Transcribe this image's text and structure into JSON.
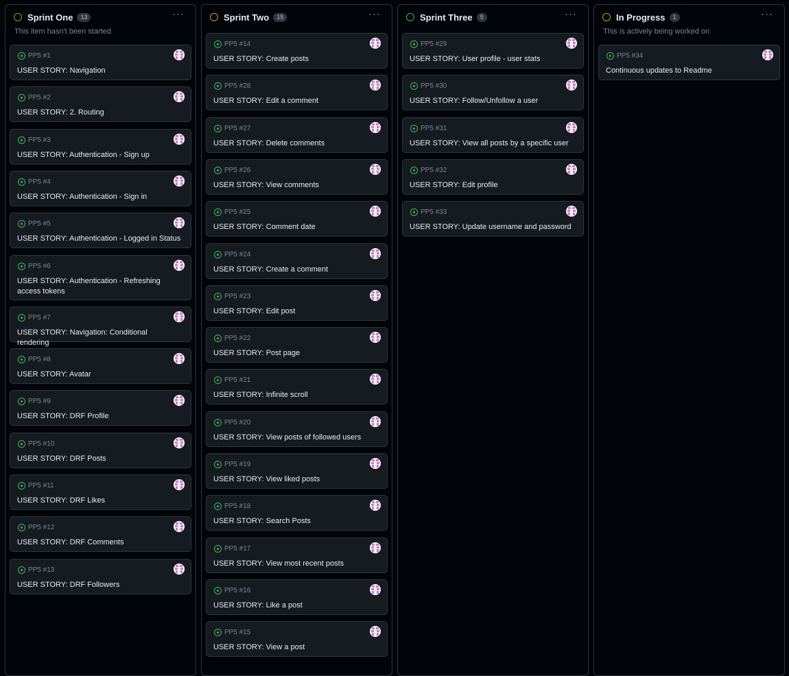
{
  "columns": [
    {
      "title": "Sprint One",
      "count": "13",
      "description": "This item hasn't been started",
      "status_color": "#3fb950",
      "items": [
        {
          "id": "PP5 #1",
          "title": "USER STORY: Navigation"
        },
        {
          "id": "PP5 #2",
          "title": "USER STORY: 2. Routing"
        },
        {
          "id": "PP5 #3",
          "title": "USER STORY: Authentication - Sign up"
        },
        {
          "id": "PP5 #4",
          "title": "USER STORY: Authentication - Sign in"
        },
        {
          "id": "PP5 #5",
          "title": "USER STORY: Authentication - Logged in Status"
        },
        {
          "id": "PP5 #6",
          "title": "USER STORY: Authentication - Refreshing access tokens"
        },
        {
          "id": "PP5 #7",
          "title": "USER STORY: Navigation: Conditional rendering"
        },
        {
          "id": "PP5 #8",
          "title": "USER STORY: Avatar"
        },
        {
          "id": "PP5 #9",
          "title": "USER STORY: DRF Profile"
        },
        {
          "id": "PP5 #10",
          "title": "USER STORY: DRF Posts"
        },
        {
          "id": "PP5 #11",
          "title": "USER STORY: DRF Likes"
        },
        {
          "id": "PP5 #12",
          "title": "USER STORY: DRF Comments"
        },
        {
          "id": "PP5 #13",
          "title": "USER STORY: DRF Followers"
        }
      ]
    },
    {
      "title": "Sprint Two",
      "count": "15",
      "description": "",
      "status_color": "#d29922",
      "items": [
        {
          "id": "PP5 #14",
          "title": "USER STORY: Create posts"
        },
        {
          "id": "PP5 #28",
          "title": "USER STORY: Edit a comment"
        },
        {
          "id": "PP5 #27",
          "title": "USER STORY: Delete comments"
        },
        {
          "id": "PP5 #26",
          "title": "USER STORY: View comments"
        },
        {
          "id": "PP5 #25",
          "title": "USER STORY: Comment date"
        },
        {
          "id": "PP5 #24",
          "title": "USER STORY: Create a comment"
        },
        {
          "id": "PP5 #23",
          "title": "USER STORY: Edit post"
        },
        {
          "id": "PP5 #22",
          "title": "USER STORY: Post page"
        },
        {
          "id": "PP5 #21",
          "title": "USER STORY: Infinite scroll"
        },
        {
          "id": "PP5 #20",
          "title": "USER STORY: View posts of followed users"
        },
        {
          "id": "PP5 #19",
          "title": "USER STORY: View liked posts"
        },
        {
          "id": "PP5 #18",
          "title": "USER STORY: Search Posts"
        },
        {
          "id": "PP5 #17",
          "title": "USER STORY: View most recent posts"
        },
        {
          "id": "PP5 #16",
          "title": "USER STORY: Like a post"
        },
        {
          "id": "PP5 #15",
          "title": "USER STORY: View a post"
        }
      ]
    },
    {
      "title": "Sprint Three",
      "count": "5",
      "description": "",
      "status_color": "#3fb950",
      "items": [
        {
          "id": "PP5 #29",
          "title": "USER STORY: User profile - user stats"
        },
        {
          "id": "PP5 #30",
          "title": "USER STORY: Follow/Unfollow a user"
        },
        {
          "id": "PP5 #31",
          "title": "USER STORY: View all posts by a specific user"
        },
        {
          "id": "PP5 #32",
          "title": "USER STORY: Edit profile"
        },
        {
          "id": "PP5 #33",
          "title": "USER STORY: Update username and password"
        }
      ]
    },
    {
      "title": "In Progress",
      "count": "1",
      "description": "This is actively being worked on",
      "status_color": "#d29922",
      "items": [
        {
          "id": "PP5 #34",
          "title": "Continuous updates to Readme"
        }
      ]
    }
  ],
  "icons": {
    "status": "status-circle-icon",
    "issue": "issue-open-icon",
    "menu": "kebab-menu-icon",
    "avatar": "identicon-avatar"
  },
  "menu_glyph": "···"
}
